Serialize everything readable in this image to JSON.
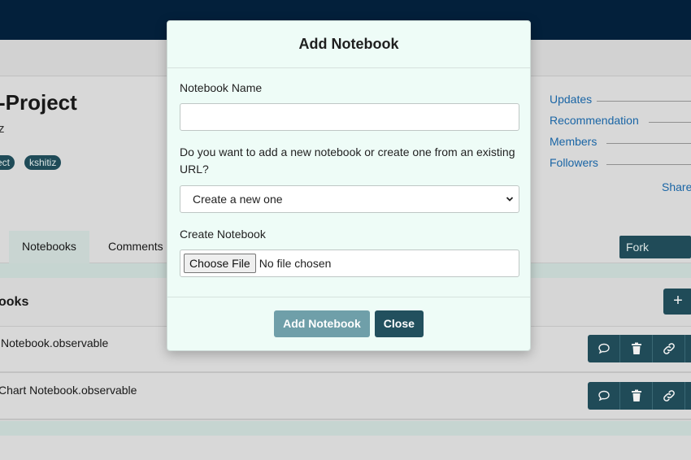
{
  "background": {
    "project_title": "-Project",
    "project_subtitle": "z",
    "tags": [
      "ect",
      "kshitiz"
    ],
    "side_links": [
      "Updates",
      "Recommendation",
      "Members",
      "Followers"
    ],
    "share_label": "Share",
    "tabs": [
      "Notebooks",
      "Comments"
    ],
    "fork_label": "Fork Project",
    "section_title": "ooks",
    "add_label": "+",
    "rows": [
      {
        "label": "Notebook.observable"
      },
      {
        "label": "Chart Notebook.observable"
      }
    ]
  },
  "modal": {
    "title": "Add Notebook",
    "name_label": "Notebook Name",
    "name_value": "",
    "question": "Do you want to add a new notebook or create one from an existing URL?",
    "select_value": "Create a new one",
    "create_label": "Create Notebook",
    "choose_file_label": "Choose File",
    "no_file_label": "No file chosen",
    "add_button": "Add Notebook",
    "close_button": "Close"
  },
  "colors": {
    "topbar": "#04223f",
    "primary": "#22505e",
    "primary_muted": "#6f9fa9",
    "modal_bg": "#eefcf7",
    "link": "#1c6cb0"
  }
}
